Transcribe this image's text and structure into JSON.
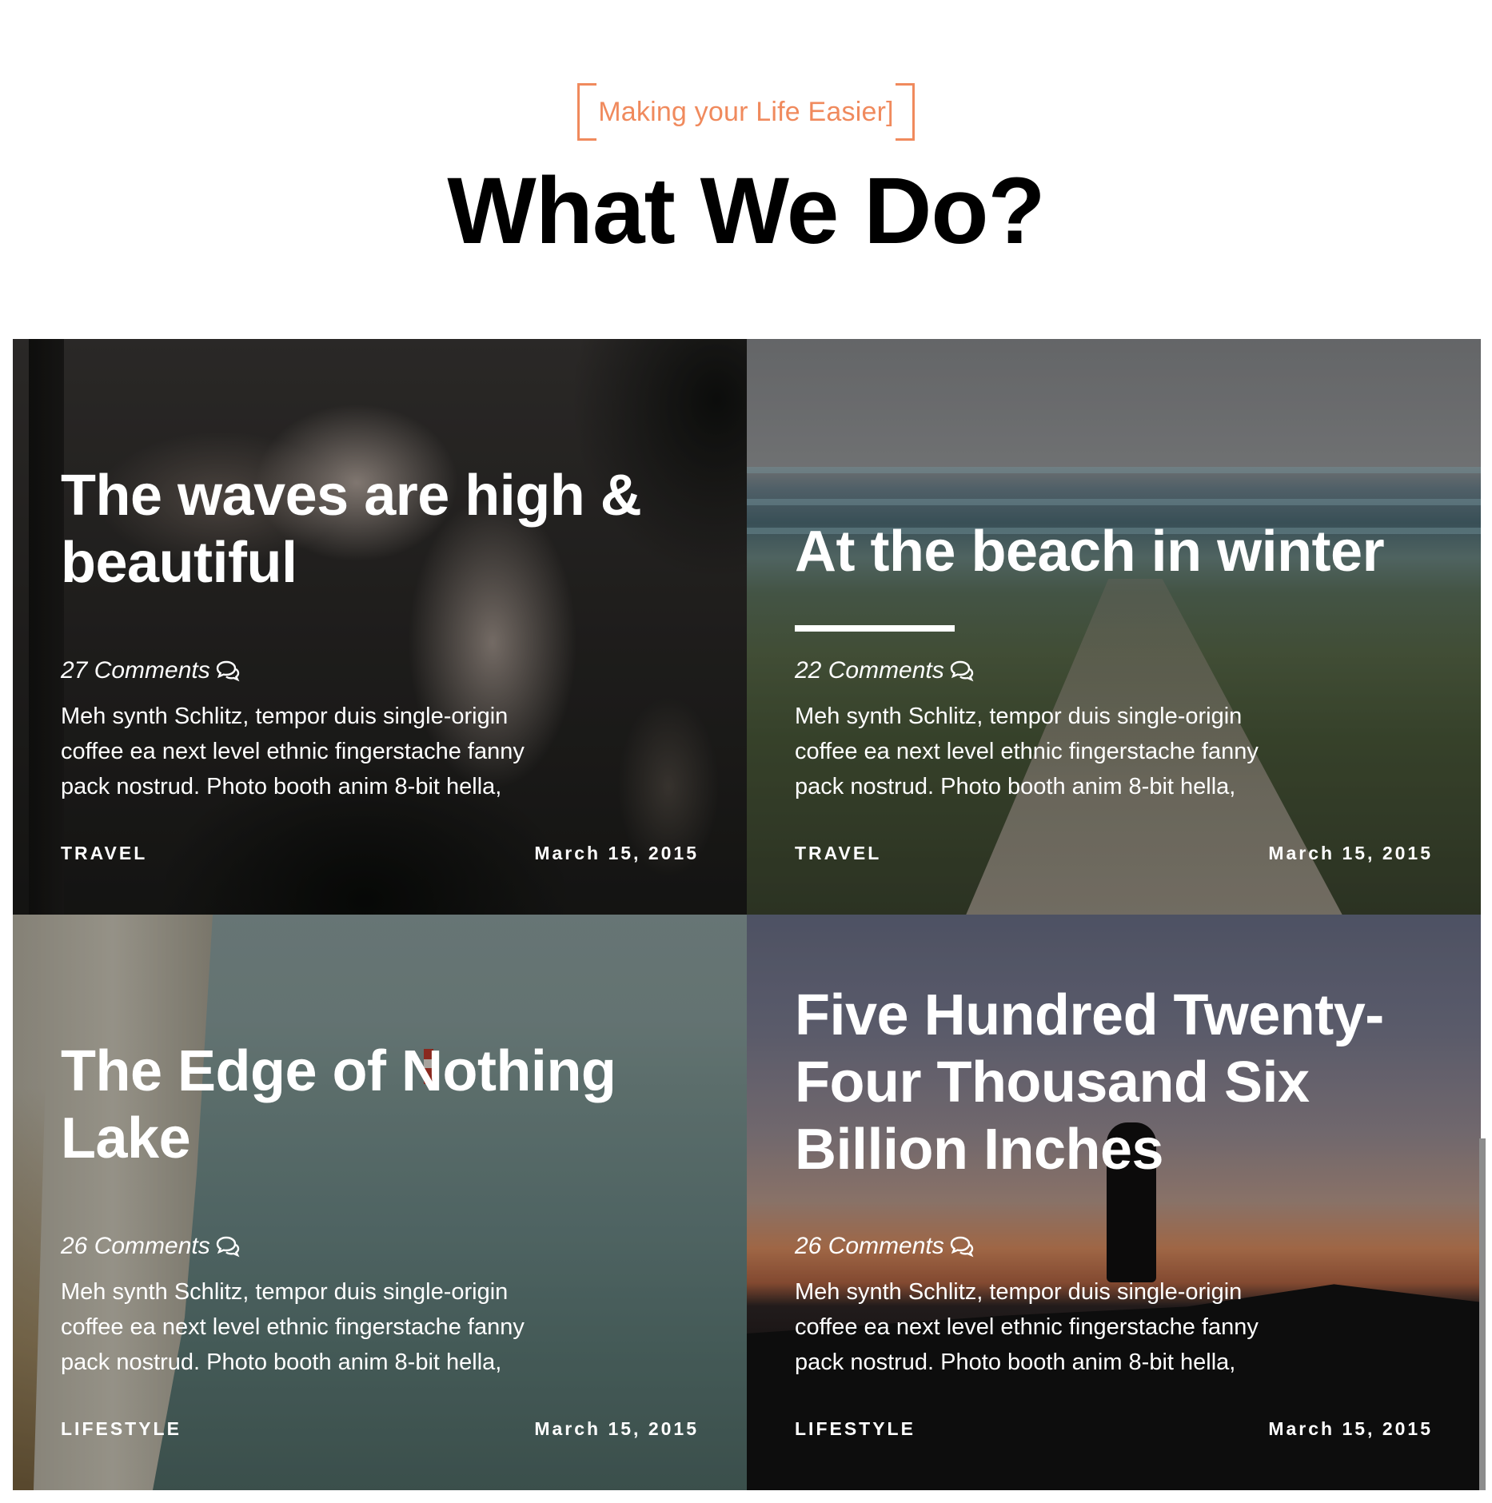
{
  "header": {
    "tagline": "Making your Life Easier]",
    "title": "What We Do?"
  },
  "colors": {
    "accent": "#f08a5d",
    "title": "#000000",
    "card_text": "#ffffff"
  },
  "icons": {
    "comment": "speech-bubbles-icon"
  },
  "posts": [
    {
      "title": "The waves are high & beautiful",
      "comments": "27 Comments",
      "excerpt": "Meh synth Schlitz, tempor duis single-origin coffee ea next level ethnic fingerstache fanny pack nostrud. Photo booth anim 8-bit hella,",
      "category": "TRAVEL",
      "date": "March 15, 2015"
    },
    {
      "title": "At the beach in winter",
      "comments": "22 Comments",
      "excerpt": "Meh synth Schlitz, tempor duis single-origin coffee ea next level ethnic fingerstache fanny pack nostrud. Photo booth anim 8-bit hella,",
      "category": "TRAVEL",
      "date": "March 15, 2015"
    },
    {
      "title": "The Edge of Nothing Lake",
      "comments": "26 Comments",
      "excerpt": "Meh synth Schlitz, tempor duis single-origin coffee ea next level ethnic fingerstache fanny pack nostrud. Photo booth anim 8-bit hella,",
      "category": "LIFESTYLE",
      "date": "March 15, 2015"
    },
    {
      "title": "Five Hundred Twenty-Four Thousand Six Billion Inches",
      "comments": "26 Comments",
      "excerpt": "Meh synth Schlitz, tempor duis single-origin coffee ea next level ethnic fingerstache fanny pack nostrud. Photo booth anim 8-bit hella,",
      "category": "LIFESTYLE",
      "date": "March 15, 2015"
    }
  ]
}
